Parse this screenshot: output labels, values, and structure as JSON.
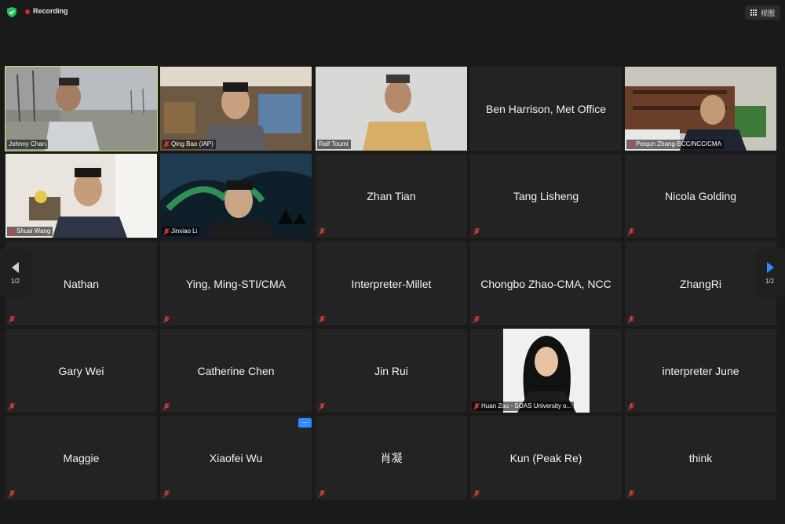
{
  "topbar": {
    "recording_label": "Recording",
    "view_label": "视图"
  },
  "pagination": {
    "left_page": "1/2",
    "right_page": "1/2"
  },
  "colors": {
    "active_speaker_border": "#cde36d",
    "recording_dot": "#e02828",
    "more_button": "#2d8cff",
    "shield": "#25c35a"
  },
  "icons": {
    "shield": "shield-check-icon",
    "muted": "mic-muted-icon",
    "grid": "grid-icon",
    "more": "ellipsis-icon"
  },
  "participants": [
    {
      "name": "Johnny Chan",
      "video": true,
      "muted": false,
      "active": true
    },
    {
      "name": "Qing Bao (IAP)",
      "video": true,
      "muted": true
    },
    {
      "name": "Ralf Toumi",
      "video": true,
      "muted": false
    },
    {
      "name": "Ben Harrison, Met Office",
      "video": false,
      "muted": false
    },
    {
      "name": "Peiqun Zhang-BCC/NCC/CMA",
      "video": true,
      "muted": true
    },
    {
      "name": "Shuai Wang",
      "video": true,
      "muted": true
    },
    {
      "name": "Jinxiao Li",
      "video": true,
      "muted": true
    },
    {
      "name": "Zhan Tian",
      "video": false,
      "muted": true
    },
    {
      "name": "Tang Lisheng",
      "video": false,
      "muted": true
    },
    {
      "name": "Nicola Golding",
      "video": false,
      "muted": true
    },
    {
      "name": "Nathan",
      "video": false,
      "muted": true
    },
    {
      "name": "Ying, Ming-STI/CMA",
      "video": false,
      "muted": true
    },
    {
      "name": "Interpreter-Millet",
      "video": false,
      "muted": true
    },
    {
      "name": "Chongbo Zhao-CMA, NCC",
      "video": false,
      "muted": true
    },
    {
      "name": "ZhangRi",
      "video": false,
      "muted": true
    },
    {
      "name": "Gary Wei",
      "video": false,
      "muted": true
    },
    {
      "name": "Catherine Chen",
      "video": false,
      "muted": true
    },
    {
      "name": "Jin Rui",
      "video": false,
      "muted": true
    },
    {
      "name": "Huan Zou  - SOAS University o...",
      "video": true,
      "muted": true
    },
    {
      "name": "interpreter June",
      "video": false,
      "muted": true
    },
    {
      "name": "Maggie",
      "video": false,
      "muted": true
    },
    {
      "name": "Xiaofei Wu",
      "video": false,
      "muted": true
    },
    {
      "name": "肖凝",
      "video": false,
      "muted": true
    },
    {
      "name": "Kun (Peak Re)",
      "video": false,
      "muted": true
    },
    {
      "name": "think",
      "video": false,
      "muted": true
    }
  ]
}
